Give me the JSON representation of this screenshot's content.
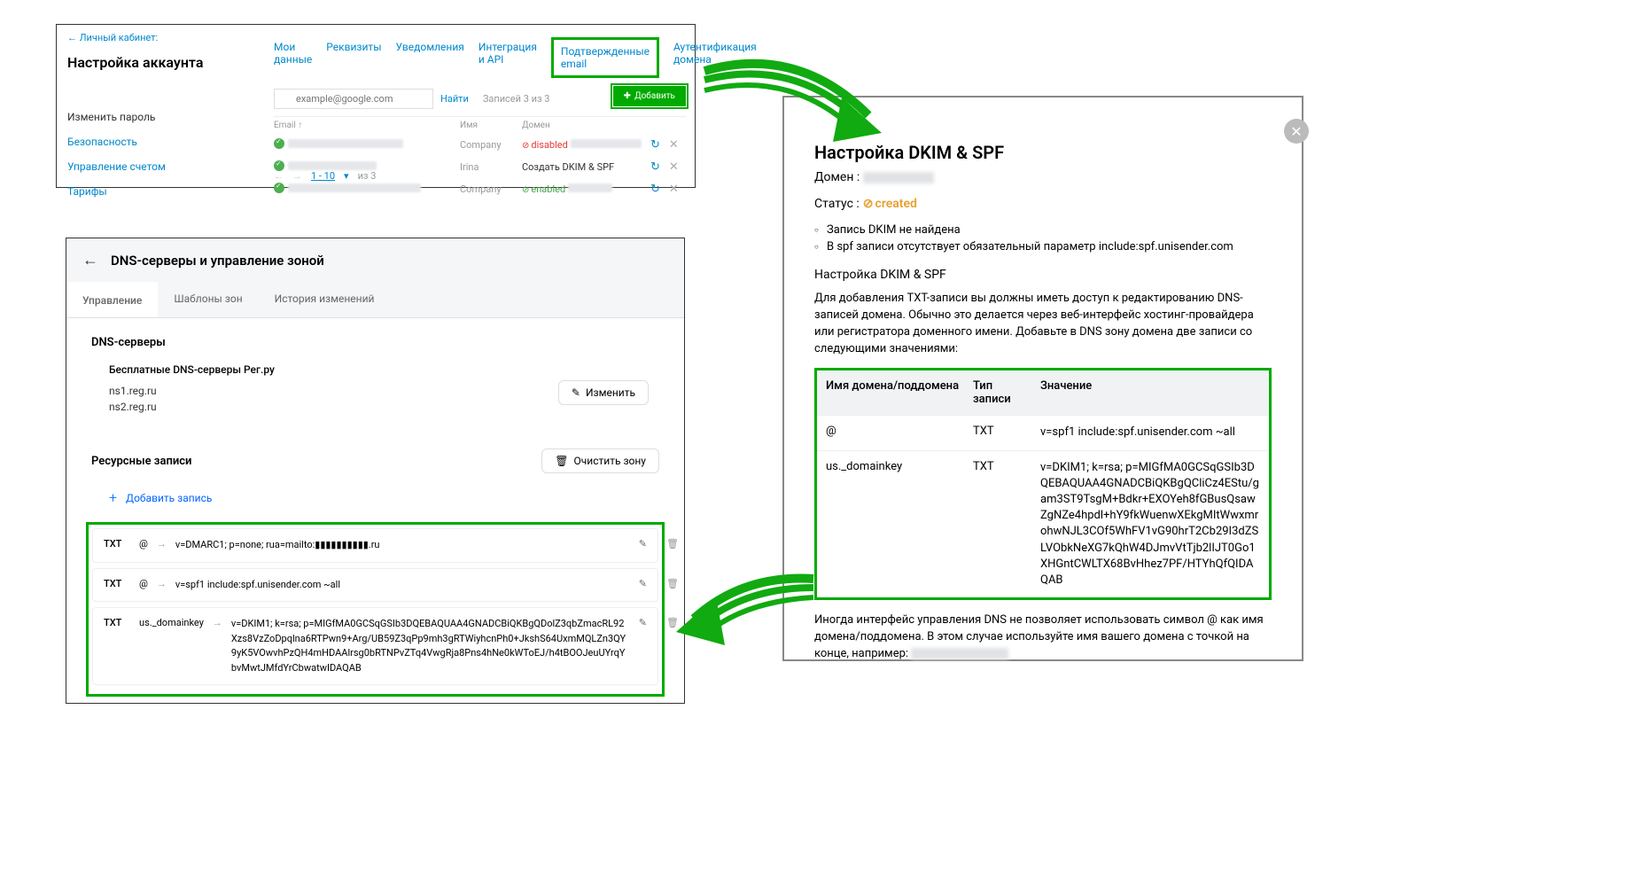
{
  "panel1": {
    "back": "← Личный кабинет:",
    "title": "Настройка аккаунта",
    "sidebar": [
      "Изменить пароль",
      "Безопасность",
      "Управление счетом",
      "Тарифы"
    ],
    "tabs": [
      "Мои данные",
      "Реквизиты",
      "Уведомления",
      "Интеграция и API",
      "Подтвержденные email",
      "Аутентификация домена"
    ],
    "search_placeholder": "example@google.com",
    "find": "Найти",
    "count_label": "Записей 3 из 3",
    "add_btn": "Добавить",
    "th_email": "Email ↑",
    "th_name": "Имя",
    "th_domain": "Домен",
    "rows": [
      {
        "name": "Company",
        "status_text": "disabled",
        "status_class": "disabled"
      },
      {
        "name": "Irina",
        "status_text": "Создать DKIM & SPF",
        "status_class": "create"
      },
      {
        "name": "Company",
        "status_text": "enabled",
        "status_class": "enabled"
      }
    ],
    "pager_range": "1 - 10",
    "pager_of": "из 3"
  },
  "panel2": {
    "title": "DNS-серверы и управление зоной",
    "tabs": [
      "Управление",
      "Шаблоны зон",
      "История изменений"
    ],
    "section_dns": "DNS-серверы",
    "free_dns": "Бесплатные DNS-серверы Рег.ру",
    "ns": [
      "ns1.reg.ru",
      "ns2.reg.ru"
    ],
    "change_btn": "Изменить",
    "section_records": "Ресурсные записи",
    "clear_btn": "Очистить зону",
    "add_record": "Добавить запись",
    "records": [
      {
        "type": "TXT",
        "host": "@",
        "value": "v=DMARC1; p=none; rua=mailto:▮▮▮▮▮▮▮▮▮▮.ru"
      },
      {
        "type": "TXT",
        "host": "@",
        "value": "v=spf1 include:spf.unisender.com ~all"
      },
      {
        "type": "TXT",
        "host": "us._domainkey",
        "value": "v=DKIM1; k=rsa; p=MIGfMA0GCSqGSIb3DQEBAQUAA4GNADCBiQKBgQDolZ3qbZmacRL92Xzs8VzZoDpqlna6RTPwn9+Arg/UB59Z3qPp9mh3gRTWiyhcnPh0+JkshS64UxmMQLZn3QY9yK5VOwvhPzQH4mHDAAlrsg0bRTNPvZTq4VwgRja8Pns4hNe0kWToEJ/h4tBOOJeuUYrqYbvMwtJMfdYrCbwatwIDAQAB"
      }
    ]
  },
  "panel3": {
    "title": "Настройка DKIM & SPF",
    "domain_label": "Домен :",
    "status_label": "Статус :",
    "status_value": "created",
    "notes": [
      "Запись DKIM не найдена",
      "В spf записи отсутствует обязательный параметр include:spf.unisender.com"
    ],
    "sub": "Настройка DKIM & SPF",
    "desc": "Для добавления TXT-записи вы должны иметь доступ к редактированию DNS-записей домена. Обычно это делается через веб-интерфейс хостинг-провайдера или регистратора доменного имени. Добавьте в DNS зону домена две записи со следующими значениями:",
    "th1": "Имя домена/поддомена",
    "th2": "Тип записи",
    "th3": "Значение",
    "rows": [
      {
        "host": "@",
        "type": "TXT",
        "value": "v=spf1 include:spf.unisender.com ~all"
      },
      {
        "host": "us._domainkey",
        "type": "TXT",
        "value": "v=DKIM1; k=rsa; p=MIGfMA0GCSqGSIb3DQEBAQUAA4GNADCBiQKBgQCliCz4EStu/gam3ST9TsgM+Bdkr+EXOYeh8fGBusQsawZgNZe4hpdl+hY9fkWuenwXEkgMItWwxmrohwNJL3COf5WhFV1vG90hrT2Cb29I3dZSLVObkNeXG7kQhW4DJmvVtTjb2lIJT0Go1XHGntCWLTX68BvHhez7PF/HTYhQfQIDAQAB"
      }
    ],
    "footer": "Иногда интерфейс управления DNS не позволяет использовать символ @ как имя домена/поддомена. В этом случае используйте имя вашего домена с точкой на конце, например:"
  }
}
